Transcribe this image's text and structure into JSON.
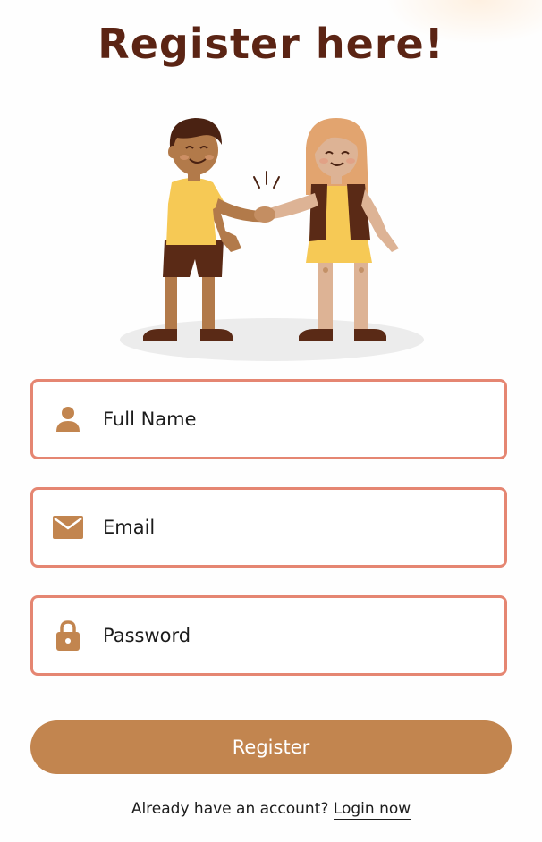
{
  "title": "Register here!",
  "fields": {
    "full_name": {
      "placeholder": "Full Name",
      "icon": "user-icon"
    },
    "email": {
      "placeholder": "Email",
      "icon": "envelope-icon"
    },
    "password": {
      "placeholder": "Password",
      "icon": "lock-icon"
    }
  },
  "register_button": {
    "label": "Register"
  },
  "footer": {
    "prompt": "Already have an account?",
    "login_link": "Login now"
  },
  "colors": {
    "title": "#5b2414",
    "field_border": "#e58672",
    "icon": "#c2854f",
    "button": "#c2854f",
    "button_text": "#ffffff"
  }
}
